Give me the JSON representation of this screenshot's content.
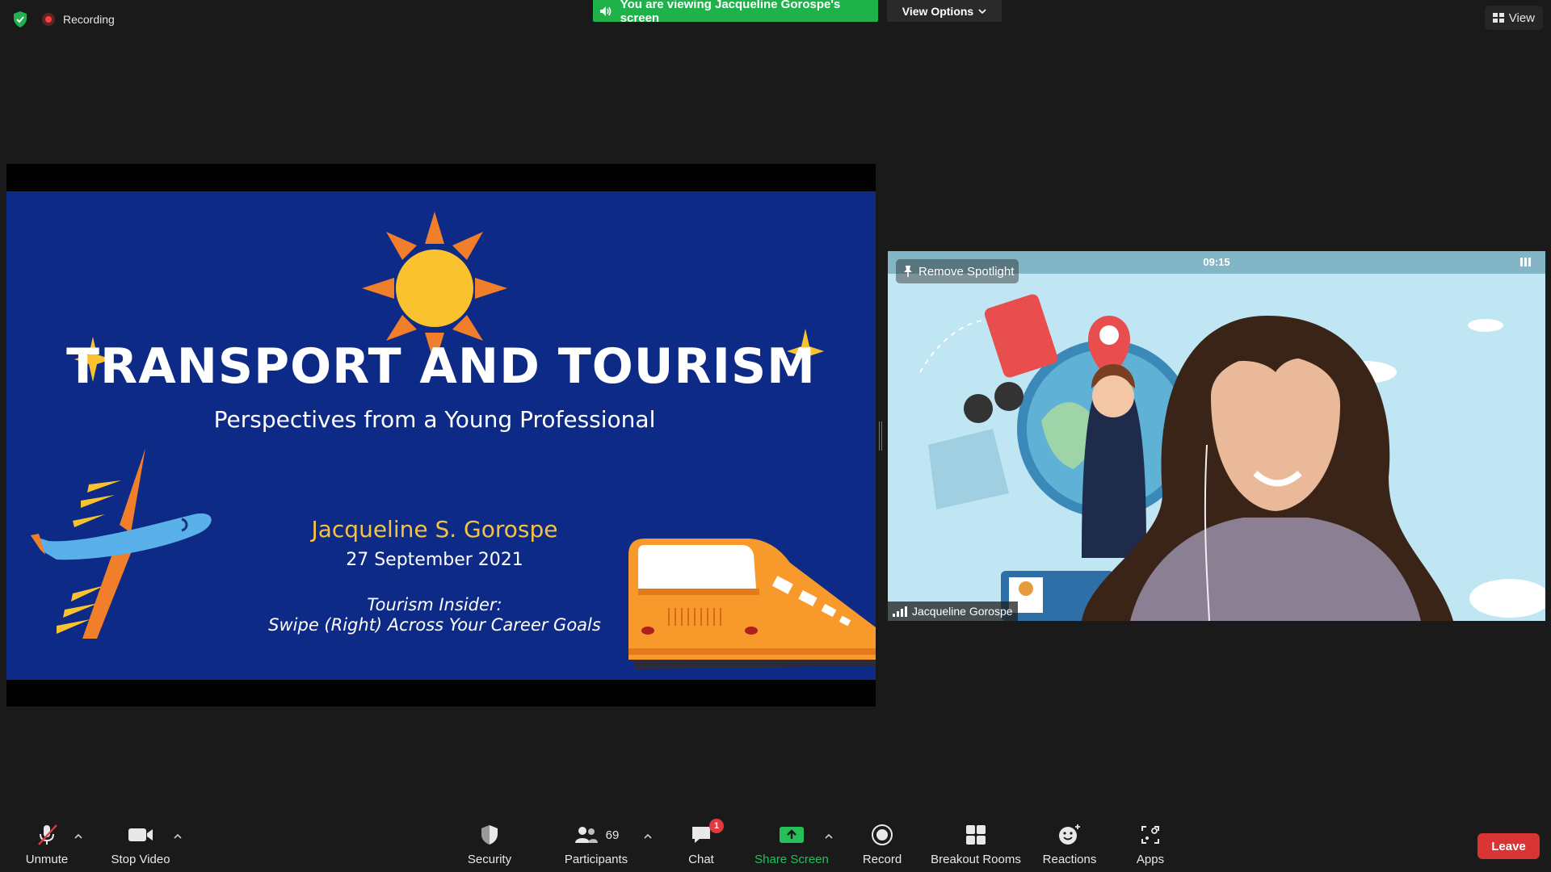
{
  "top_bar": {
    "recording_label": "Recording",
    "viewing_banner": "You are viewing Jacqueline Gorospe's screen",
    "view_options_label": "View Options",
    "view_label": "View"
  },
  "slide": {
    "title": "TRANSPORT AND TOURISM",
    "subtitle": "Perspectives from a Young Professional",
    "author": "Jacqueline S. Gorospe",
    "date": "27 September 2021",
    "event_line1": "Tourism Insider:",
    "event_line2": "Swipe (Right) Across Your Career Goals"
  },
  "video": {
    "timer": "09:15",
    "remove_spotlight_label": "Remove Spotlight",
    "participant_name": "Jacqueline Gorospe"
  },
  "toolbar": {
    "unmute_label": "Unmute",
    "stop_video_label": "Stop Video",
    "security_label": "Security",
    "participants_label": "Participants",
    "participants_count": "69",
    "chat_label": "Chat",
    "chat_badge": "1",
    "share_screen_label": "Share Screen",
    "record_label": "Record",
    "breakout_rooms_label": "Breakout Rooms",
    "reactions_label": "Reactions",
    "apps_label": "Apps",
    "leave_label": "Leave"
  },
  "colors": {
    "background": "#1a1a1a",
    "banner_green": "#1fb14a",
    "slide_blue": "#0d2a86",
    "author_gold": "#f5c342",
    "leave_red": "#d93434",
    "share_green": "#25c05a"
  }
}
